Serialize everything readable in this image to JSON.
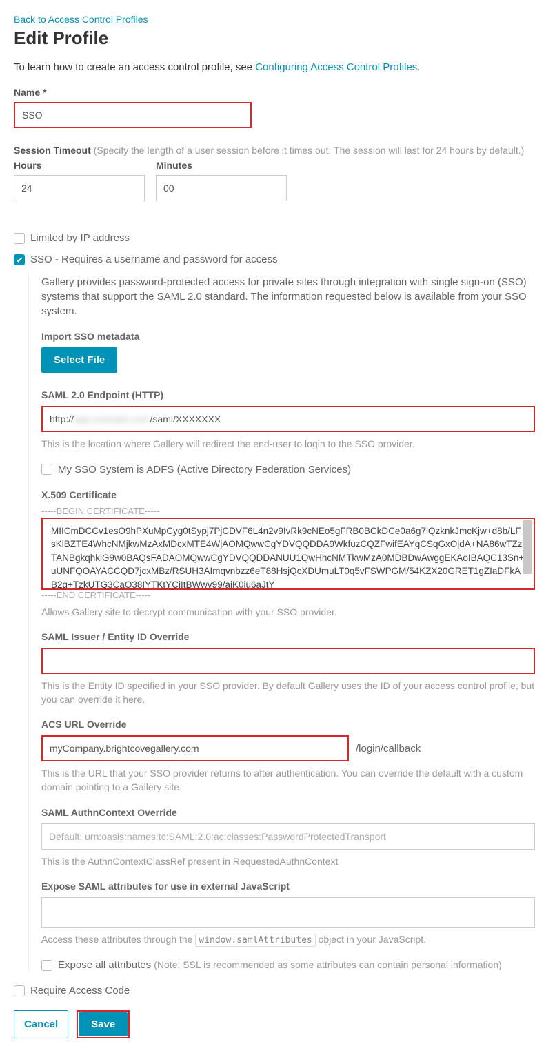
{
  "back_link": "Back to Access Control Profiles",
  "title": "Edit Profile",
  "intro_prefix": "To learn how to create an access control profile, see ",
  "intro_link": "Configuring Access Control Profiles",
  "intro_suffix": ".",
  "name_label": "Name *",
  "name_value": "SSO",
  "session_label": "Session Timeout ",
  "session_hint": "(Specify the length of a user session before it times out. The session will last for 24 hours by default.)",
  "hours_label": "Hours",
  "hours_value": "24",
  "minutes_label": "Minutes",
  "minutes_value": "00",
  "limited_ip_label": "Limited by IP address",
  "sso_checkbox_label": "SSO - Requires a username and password for access",
  "sso_desc": "Gallery provides password-protected access for private sites through integration with single sign-on (SSO) systems that support the SAML 2.0 standard. The information requested below is available from your SSO system.",
  "import_label": "Import SSO metadata",
  "select_file_label": "Select File",
  "endpoint_label": "SAML 2.0 Endpoint (HTTP)",
  "endpoint_prefix": "http://",
  "endpoint_blur": "app.example.com",
  "endpoint_suffix": "/saml/XXXXXXX",
  "endpoint_hint": "This is the location where Gallery will redirect the end-user to login to the SSO provider.",
  "adfs_label": "My SSO System is ADFS (Active Directory Federation Services)",
  "cert_label": "X.509 Certificate",
  "cert_begin": "-----BEGIN CERTIFICATE-----",
  "cert_value": "MIICmDCCv1esO9hPXuMpCyg0tSypj7PjCDVF6L4n2v9IvRk9cNEo5gFRB0BCkDCe0a6g7lQzknkJmcKjw+d8b/LFsKlBZTE4WhcNMjkwMzAxMDcxMTE4WjAOMQwwCgYDVQQDDA9WkfuzCQZFwifEAYgCSqGxOjdA+NA86wTZzTANBgkqhkiG9w0BAQsFADAOMQwwCgYDVQQDDANUU1QwHhcNMTkwMzA0MDBDwAwggEKAoIBAQC13Sn+uUNFQOAYACCQD7jcxMBz/RSUH3AImqvnbzz6eT88HsjQcXDUmuLT0q5vFSWPGM/54KZX20GRET1gZIaDFkAB2q+TzkUTG3CaO38IYTKtYCjItBWwv99/aiK0iu6aJtY",
  "cert_end": "-----END CERTIFICATE-----",
  "cert_hint": "Allows Gallery site to decrypt communication with your SSO provider.",
  "issuer_label": "SAML Issuer / Entity ID Override",
  "issuer_value": "",
  "issuer_hint": "This is the Entity ID specified in your SSO provider. By default Gallery uses the ID of your access control profile, but you can override it here.",
  "acs_label": "ACS URL Override",
  "acs_value": "myCompany.brightcovegallery.com",
  "acs_suffix": "/login/callback",
  "acs_hint": "This is the URL that your SSO provider returns to after authentication. You can override the default with a custom domain pointing to a Gallery site.",
  "authn_label": "SAML AuthnContext Override",
  "authn_value": "Default: urn:oasis:names:tc:SAML:2.0:ac:classes:PasswordProtectedTransport",
  "authn_hint": "This is the AuthnContextClassRef present in RequestedAuthnContext",
  "expose_label": "Expose SAML attributes for use in external JavaScript",
  "expose_value": "",
  "expose_hint_prefix": "Access these attributes through the ",
  "expose_hint_code": "window.samlAttributes",
  "expose_hint_suffix": " object in your JavaScript.",
  "expose_all_label": "Expose all attributes ",
  "expose_all_note": "(Note: SSL is recommended as some attributes can contain personal information)",
  "require_code_label": "Require Access Code",
  "cancel_label": "Cancel",
  "save_label": "Save"
}
